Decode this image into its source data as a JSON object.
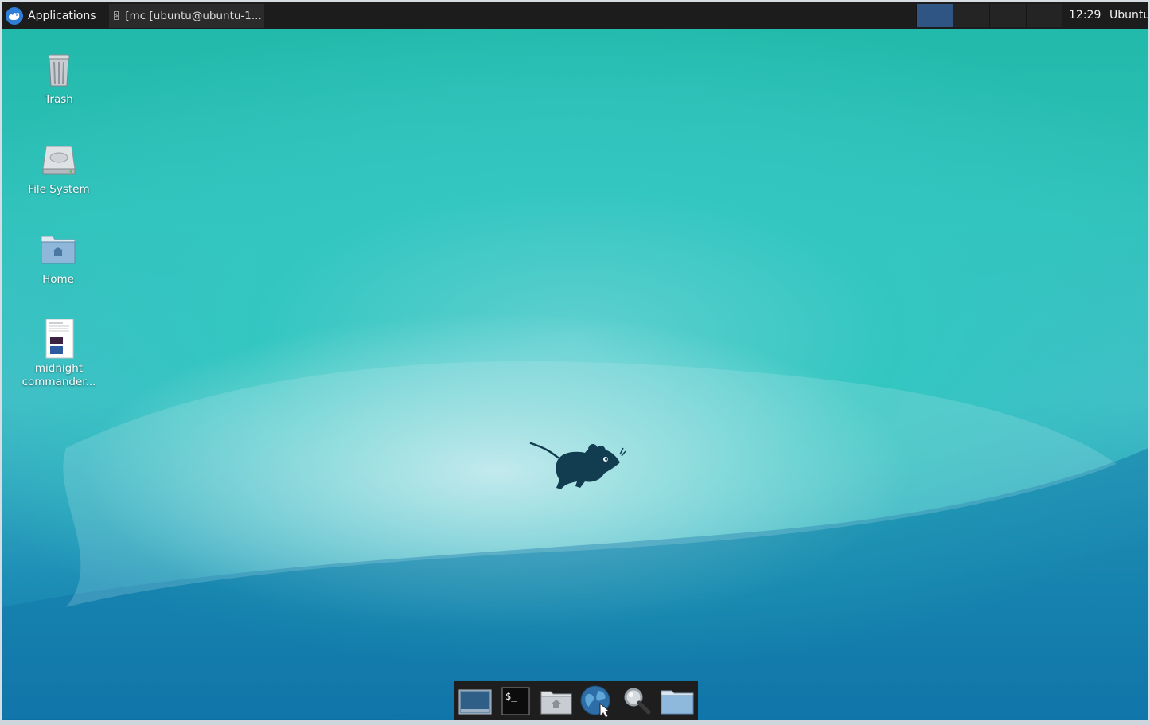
{
  "top_panel": {
    "applications_label": "Applications",
    "task_title": "[mc [ubuntu@ubuntu-1...",
    "clock": "12:29",
    "user": "Ubuntu",
    "workspaces_count": 4,
    "active_workspace": 1
  },
  "desktop_icons": [
    {
      "label": "Trash",
      "icon": "trash-icon"
    },
    {
      "label": "File System",
      "icon": "harddisk-icon"
    },
    {
      "label": "Home",
      "icon": "home-folder-icon"
    },
    {
      "label": "midnight commander...",
      "icon": "document-thumbnail-icon"
    }
  ],
  "dock": {
    "items": [
      {
        "icon": "show-desktop-icon"
      },
      {
        "icon": "terminal-icon",
        "glyph": "$_"
      },
      {
        "icon": "home-folder-icon"
      },
      {
        "icon": "web-browser-icon"
      },
      {
        "icon": "search-icon"
      },
      {
        "icon": "folder-icon"
      }
    ]
  },
  "colors": {
    "panel": "#1c1c1c",
    "active_workspace": "#2f5584",
    "wallpaper_top": "#1fb8a8",
    "wallpaper_bottom": "#0f6fa8"
  }
}
